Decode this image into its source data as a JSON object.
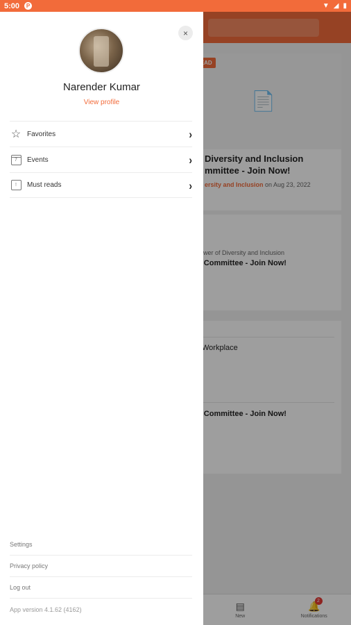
{
  "status_bar": {
    "time": "5:00",
    "app_icon": "P",
    "icons": [
      "wifi-icon",
      "signal-icon",
      "battery-icon"
    ]
  },
  "colors": {
    "accent": "#f26b3a",
    "badge": "#e53935"
  },
  "drawer": {
    "close_glyph": "×",
    "user_name": "Narender Kumar",
    "view_profile": "View profile",
    "menu": [
      {
        "label": "Favorites",
        "icon": "star-icon"
      },
      {
        "label": "Events",
        "icon": "calendar-icon"
      },
      {
        "label": "Must reads",
        "icon": "bookmark-icon"
      }
    ],
    "footer": {
      "settings": "Settings",
      "privacy": "Privacy policy",
      "logout": "Log out",
      "version": "App version 4.1.62 (4162)"
    }
  },
  "background": {
    "badge": "READ",
    "card1_title_line1": "Diversity and Inclusion",
    "card1_title_line2": "mmittee - Join Now!",
    "card1_meta_tag": "ersity and Inclusion",
    "card1_meta_date": " on Aug 23, 2022",
    "card2_meta": "llower of Diversity and Inclusion",
    "card2_title": "n Committee - Join Now!",
    "card3_title": "Workplace",
    "card4_title": "n Committee - Join Now!",
    "nav_new": "New",
    "nav_notifications": "Notifications",
    "notification_count": "2"
  }
}
